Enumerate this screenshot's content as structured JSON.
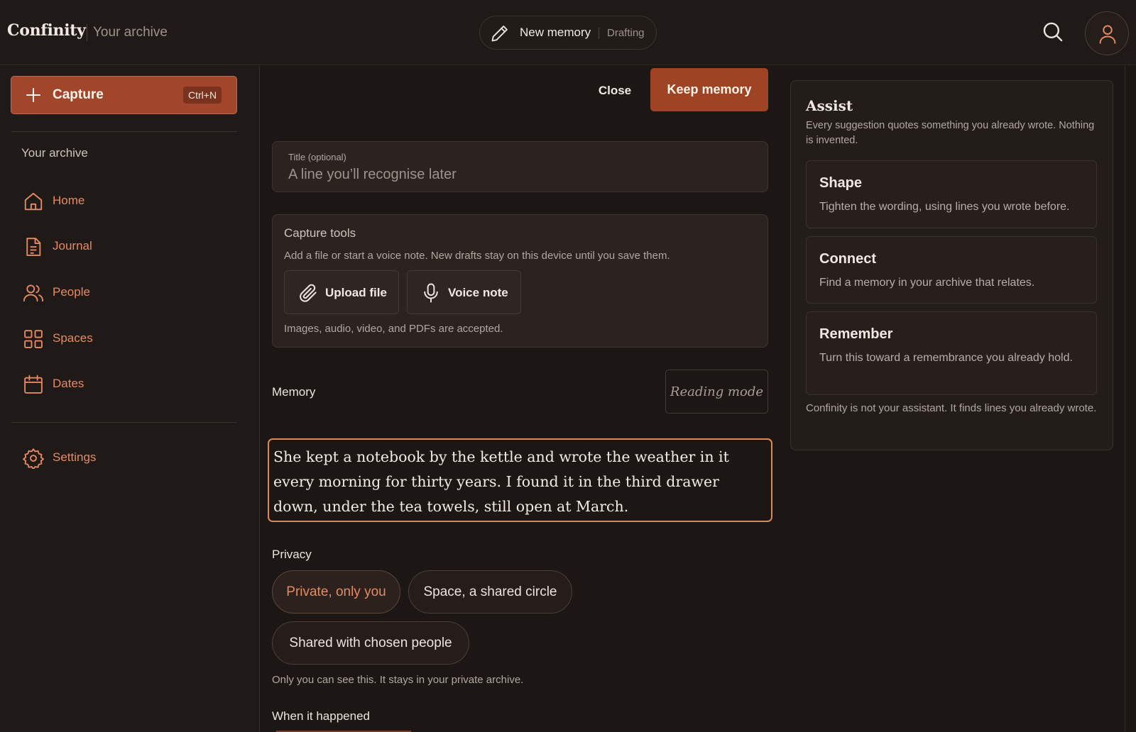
{
  "header": {
    "brand": "Confinity",
    "subtitle": "Your archive",
    "draft_label": "New memory",
    "draft_status": "Drafting",
    "icons": {
      "draft": "pencil-icon",
      "search": "search-icon",
      "account": "user-icon"
    }
  },
  "sidebar": {
    "capture_label": "Capture",
    "capture_shortcut": "Ctrl+N",
    "heading": "Your archive",
    "items": [
      {
        "label": "Home",
        "icon": "home-icon"
      },
      {
        "label": "Journal",
        "icon": "document-icon"
      },
      {
        "label": "People",
        "icon": "people-icon"
      },
      {
        "label": "Spaces",
        "icon": "grid-icon"
      },
      {
        "label": "Dates",
        "icon": "calendar-icon"
      }
    ],
    "settings_label": "Settings",
    "accent_color": "#e58a63"
  },
  "editor": {
    "close_label": "Close",
    "keep_label": "Keep memory",
    "title_label": "Title (optional)",
    "title_placeholder": "A line you’ll recognise later",
    "title_value": "",
    "tools": {
      "heading": "Capture tools",
      "description": "Add a file or start a voice note. New drafts stay on this device until you save them.",
      "upload_label": "Upload file",
      "voice_label": "Voice note",
      "footnote": "Images, audio, video, and PDFs are accepted."
    },
    "memory_label": "Memory",
    "reading_mode_label": "Reading mode",
    "memory_text": "She kept a notebook by the kettle and wrote the weather in it every morning for thirty years. I found it in the third drawer down, under the tea towels, still open at March.",
    "privacy_label": "Privacy",
    "privacy_options": [
      "Private, only you",
      "Space, a shared circle",
      "Shared with chosen people"
    ],
    "privacy_selected": "Private, only you",
    "privacy_note": "Only you can see this. It stays in your private archive.",
    "when_label": "When it happened"
  },
  "assist": {
    "heading": "Assist",
    "description": "Every suggestion quotes something you already wrote. Nothing is invented.",
    "cards": [
      {
        "title": "Shape",
        "description": "Tighten the wording, using lines you wrote before."
      },
      {
        "title": "Connect",
        "description": "Find a memory in your archive that relates."
      },
      {
        "title": "Remember",
        "description": "Turn this toward a remembrance you already hold."
      }
    ],
    "footer": "Confinity is not your assistant. It finds lines you already wrote."
  },
  "colors": {
    "background": "#1c1714",
    "primary_button": "#9f4325",
    "accent": "#e58a63",
    "focus_border": "#e0894f"
  }
}
